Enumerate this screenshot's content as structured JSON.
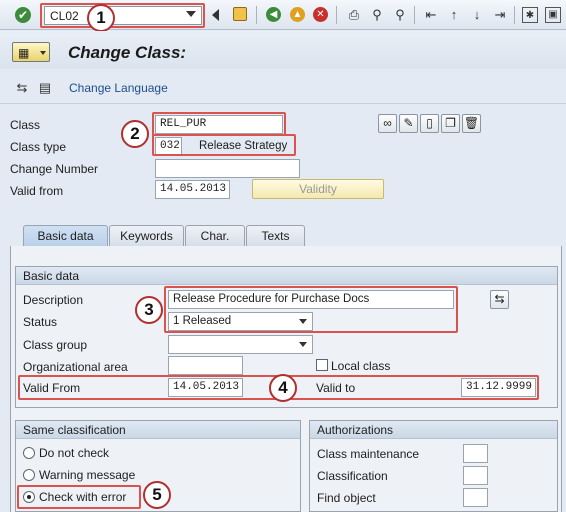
{
  "toolbar": {
    "command_field": "CL02",
    "icons": [
      "enter-icon",
      "back-arrow-icon",
      "save-icon",
      "back-icon",
      "exit-icon",
      "cancel-icon",
      "print-icon",
      "find-icon",
      "find-next-icon",
      "first-page-icon",
      "prev-page-icon",
      "next-page-icon",
      "last-page-icon",
      "new-session-icon",
      "help-icon"
    ]
  },
  "title": "Change Class:",
  "subtoolbar": {
    "change_language": "Change Language"
  },
  "header": {
    "class_label": "Class",
    "class_value": "REL_PUR",
    "class_type_label": "Class type",
    "class_type_code": "032",
    "class_type_text": "Release Strategy",
    "change_number_label": "Change Number",
    "change_number_value": "",
    "valid_from_label": "Valid from",
    "valid_from_value": "14.05.2013",
    "validity_button": "Validity"
  },
  "tabs": [
    {
      "label": "Basic data"
    },
    {
      "label": "Keywords"
    },
    {
      "label": "Char."
    },
    {
      "label": "Texts"
    }
  ],
  "basic_data": {
    "group_title": "Basic data",
    "description_label": "Description",
    "description_value": "Release Procedure for Purchase Docs",
    "status_label": "Status",
    "status_value": "1 Released",
    "class_group_label": "Class group",
    "class_group_value": "",
    "org_area_label": "Organizational area",
    "org_area_value": "",
    "local_class_label": "Local class",
    "valid_from_label": "Valid From",
    "valid_from_value": "14.05.2013",
    "valid_to_label": "Valid to",
    "valid_to_value": "31.12.9999"
  },
  "same_classification": {
    "group_title": "Same classification",
    "options": [
      "Do not check",
      "Warning message",
      "Check with error"
    ],
    "selected": "Check with error"
  },
  "authorizations": {
    "group_title": "Authorizations",
    "class_maintenance_label": "Class maintenance",
    "classification_label": "Classification",
    "find_object_label": "Find object"
  },
  "callouts": [
    "1",
    "2",
    "3",
    "4",
    "5"
  ],
  "colors": {
    "annotation_red": "#d9534f",
    "background": "#e3eaf3",
    "title_text": "#1a1a1a"
  }
}
